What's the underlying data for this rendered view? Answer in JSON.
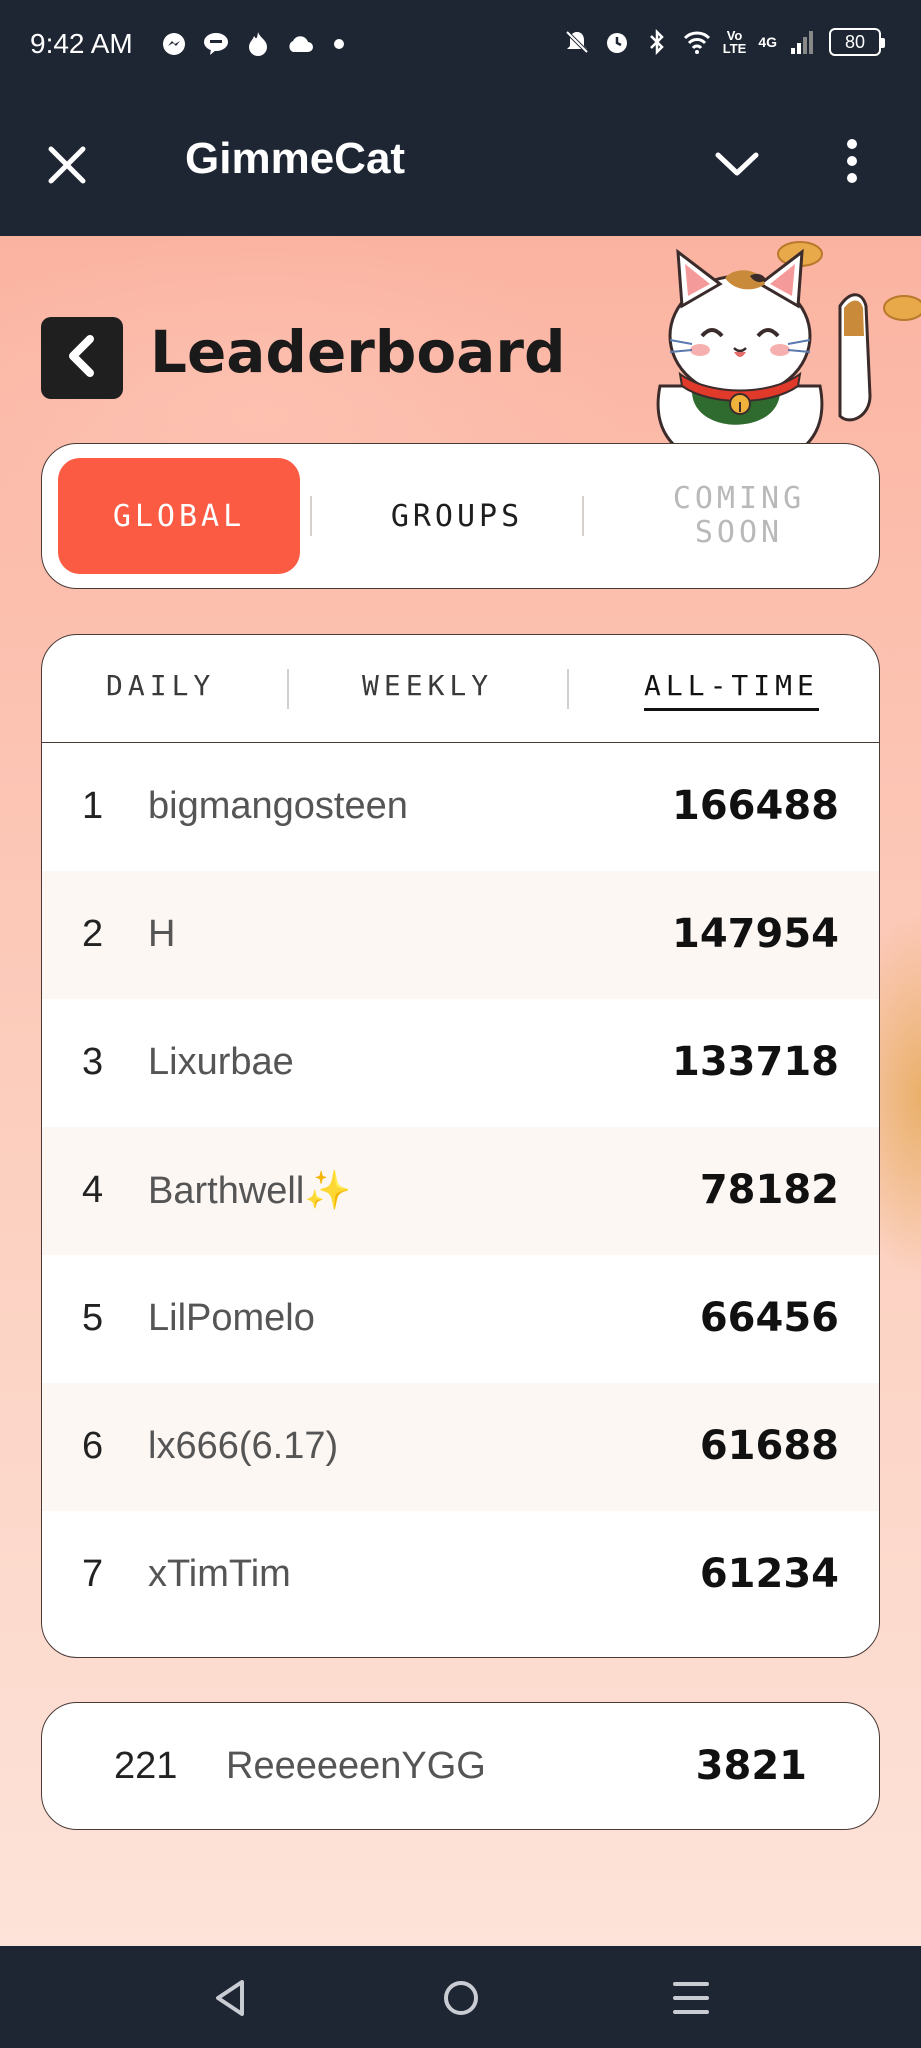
{
  "status_bar": {
    "time": "9:42 AM",
    "lte_label": "Vo\nLTE",
    "network": "4G",
    "battery": "80"
  },
  "app_bar": {
    "title": "GimmeCat"
  },
  "page": {
    "title": "Leaderboard"
  },
  "tabs": [
    {
      "label": "GLOBAL",
      "active": true
    },
    {
      "label": "GROUPS",
      "active": false
    },
    {
      "label": "COMING SOON",
      "active": false,
      "disabled": true
    }
  ],
  "subtabs": [
    {
      "label": "DAILY",
      "active": false
    },
    {
      "label": "WEEKLY",
      "active": false
    },
    {
      "label": "ALL-TIME",
      "active": true
    }
  ],
  "leaderboard": [
    {
      "rank": "1",
      "name": "bigmangosteen",
      "score": "166488"
    },
    {
      "rank": "2",
      "name": "H",
      "score": "147954"
    },
    {
      "rank": "3",
      "name": "Lixurbae",
      "score": "133718"
    },
    {
      "rank": "4",
      "name": "Barthwell✨",
      "score": "78182"
    },
    {
      "rank": "5",
      "name": "LilPomelo",
      "score": "66456"
    },
    {
      "rank": "6",
      "name": "lx666(6.17)",
      "score": "61688"
    },
    {
      "rank": "7",
      "name": "xTimTim",
      "score": "61234"
    }
  ],
  "my_rank": {
    "rank": "221",
    "name": "ReeeeeenYGG",
    "score": "3821"
  },
  "colors": {
    "accent": "#fb5a43",
    "bar": "#1e2533",
    "background_top": "#fbb3a1",
    "background_bottom": "#fde3d9"
  },
  "icons": {
    "close": "close-icon",
    "collapse": "chevron-down-icon",
    "more": "more-vert-icon",
    "back": "chevron-left-icon",
    "nav_back": "nav-back-icon",
    "nav_home": "nav-home-icon",
    "nav_recents": "nav-recents-icon"
  }
}
